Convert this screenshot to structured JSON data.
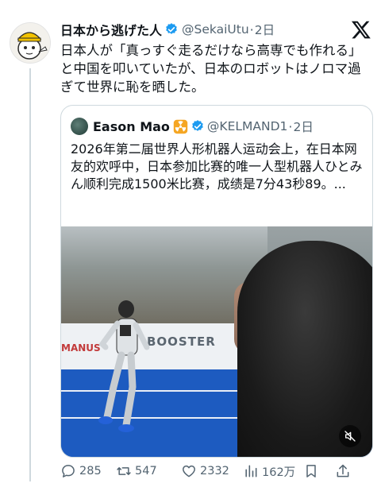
{
  "post": {
    "author_name": "日本から逃げた人",
    "author_handle": "@SekaiUtu",
    "separator": "·",
    "time": "2日",
    "text": "日本人が「真っすぐ走るだけなら高専でも作れる」と中国を叩いていたが、日本のロボットはノロマ過ぎて世界に恥を晒した。"
  },
  "quote": {
    "author_name": "Eason Mao",
    "author_handle": "@KELMAND1",
    "separator": "·",
    "time": "2日",
    "text": "2026年第二届世界人形机器人运动会上，在日本网友的欢呼中，日本参加比赛的唯一人型机器人ひとみん顺利完成1500米比赛，成绩是7分43秒89。..."
  },
  "video": {
    "sign_text": "BOOSTER",
    "sign_text_left": "MANUS",
    "muted": true
  },
  "actions": {
    "replies": "285",
    "reposts": "547",
    "likes": "2332",
    "views": "162万"
  },
  "colors": {
    "verified": "#1d9bf0",
    "secondary_text": "#536471",
    "border": "#cfd9de",
    "track_blue": "#1d5bc0"
  }
}
